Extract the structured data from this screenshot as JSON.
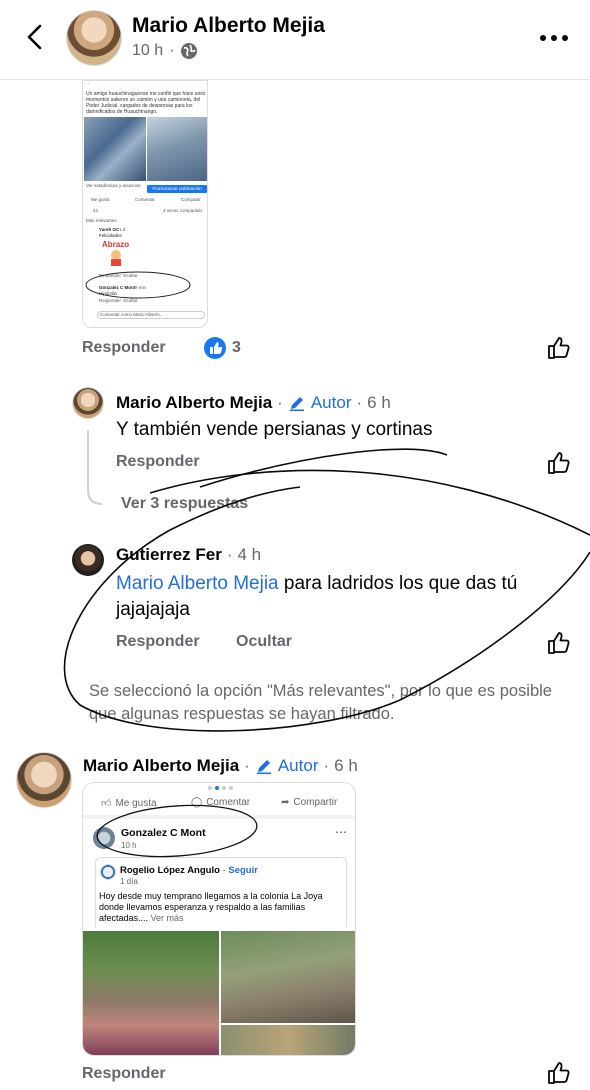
{
  "header": {
    "name": "Mario Alberto Mejia",
    "time": "10 h",
    "dot": "·"
  },
  "shot1": {
    "text": "Un amigo huauchinaguense me confió que hace unos momentos salieron un camión y una camioneta, del Poder Judicial, cargados de despensas para los damnificados de Huauchinango.",
    "stats_link": "Ver estadísticas y anuncios",
    "promote": "Promocionar publicación",
    "like": "Me gusta",
    "comment": "Comentar",
    "share": "Compartir",
    "reactions": "42",
    "shared": "4 veces compartido",
    "filter": "Más relevantes",
    "c1_name": "Yareh GC",
    "c1_time": "1 d",
    "c1_text": "Felicidades",
    "sticker": "Abrazo",
    "c1_reply": "Responder",
    "c1_hide": "Ocultar",
    "c2_name": "Gonzalez C Mont",
    "c2_time": "9 min",
    "c2_text": "Hipócrita",
    "c2_reply": "Responder",
    "c2_hide": "Ocultar",
    "composer": "Comentar como Mario Alberto..."
  },
  "first_actions": {
    "reply": "Responder",
    "like_count": "3"
  },
  "comment1": {
    "name": "Mario Alberto Mejia",
    "badge": "Autor",
    "time": "6 h",
    "text": "Y también vende persianas y cortinas",
    "reply": "Responder",
    "view_replies": "Ver 3 respuestas"
  },
  "comment2": {
    "name": "Gutierrez Fer",
    "time": "4 h",
    "mention": "Mario Alberto Mejia",
    "text": " para ladridos los que das tú jajajajaja",
    "reply": "Responder",
    "hide": "Ocultar"
  },
  "filter_note": "Se seleccionó la opción \"Más relevantes\", por lo que es posible que algunas respuestas se hayan filtrado.",
  "comment3": {
    "name": "Mario Alberto Mejia",
    "badge": "Autor",
    "time": "6 h",
    "card": {
      "like": "Me gusta",
      "comment": "Comentar",
      "share": "Compartir",
      "poster": "Gonzalez C Mont",
      "poster_time": "10 h",
      "shared_name": "Rogelio López Angulo",
      "follow": "Seguir",
      "shared_time": "1 día",
      "shared_text": "Hoy desde muy temprano llegamos a la colonia La Joya donde llevamos esperanza y respaldo a las familias afectadas....",
      "see_more": "Ver más"
    },
    "reply": "Responder"
  },
  "colors": {
    "accent": "#216fdb",
    "secondary_text": "#65676b",
    "like_blue": "#1877f2"
  }
}
